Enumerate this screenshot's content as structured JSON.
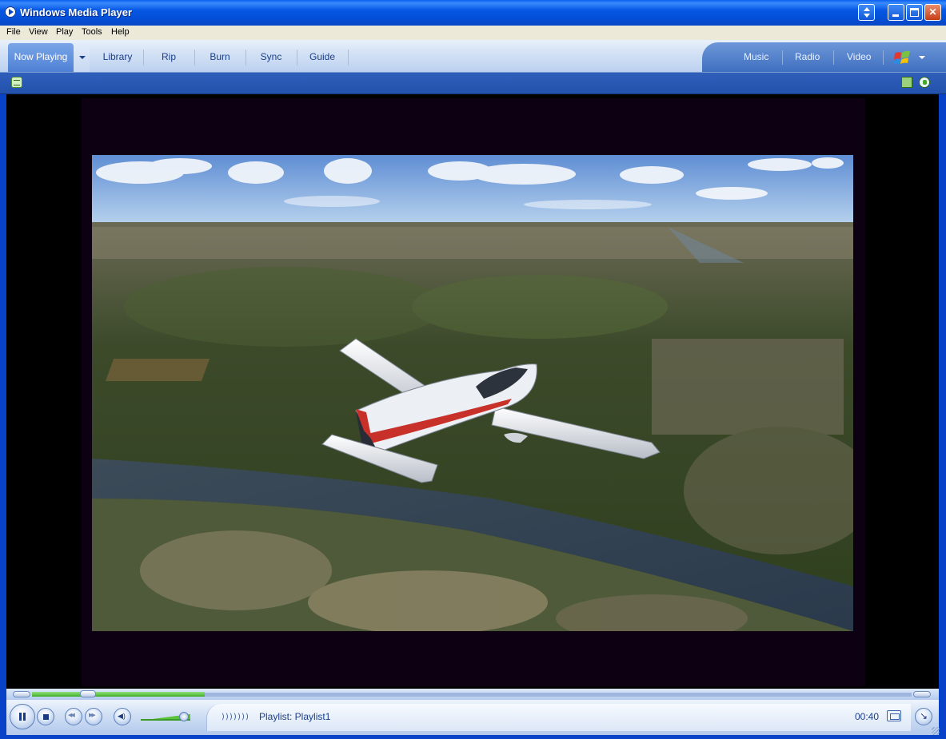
{
  "window": {
    "title": "Windows Media Player"
  },
  "menu": [
    "File",
    "View",
    "Play",
    "Tools",
    "Help"
  ],
  "tabs": {
    "now_playing": "Now Playing",
    "library": "Library",
    "rip": "Rip",
    "burn": "Burn",
    "sync": "Sync",
    "guide": "Guide"
  },
  "store_tabs": {
    "music": "Music",
    "radio": "Radio",
    "video": "Video"
  },
  "playback": {
    "status": "Playlist: Playlist1",
    "time": "00:40",
    "progress_fraction": 0.064,
    "volume_fraction": 0.85,
    "state": "playing"
  },
  "icons": {
    "eq": "eq-visualizer-icon",
    "app": "wmp-app-icon"
  },
  "colors": {
    "title_bar": "#0757e5",
    "seek_fill": "#3fae29",
    "accent": "#1b3f8a"
  }
}
